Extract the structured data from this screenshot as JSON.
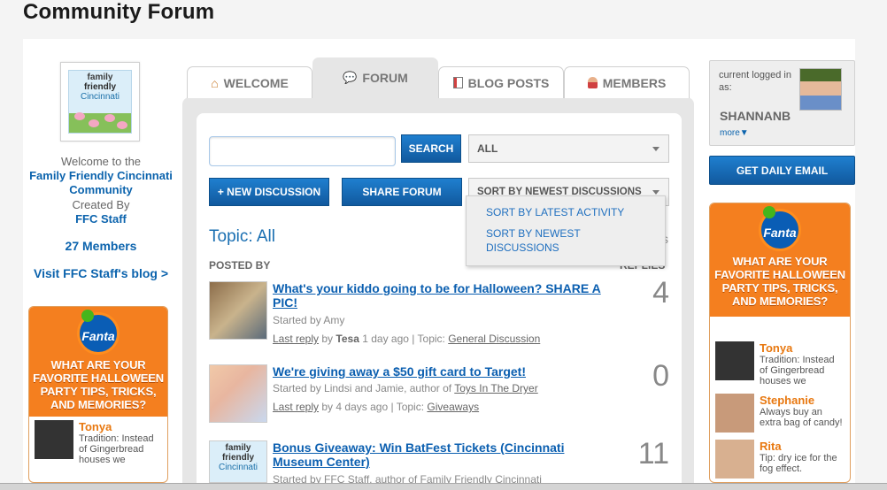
{
  "page_title": "Community Forum",
  "left": {
    "logo": {
      "line1": "family",
      "line2": "friendly",
      "line3": "Cincinnati"
    },
    "welcome_line": "Welcome to the",
    "community_name": "Family Friendly Cincinnati Community",
    "created_by_label": "Created By",
    "creator": "FFC Staff",
    "members": "27 Members",
    "blog_link": "Visit FFC Staff's blog >"
  },
  "ad": {
    "brand": "Fanta",
    "headline": "WHAT ARE YOUR FAVORITE HALLOWEEN PARTY TIPS, TRICKS, AND MEMORIES?",
    "left_items": [
      {
        "name": "Tonya",
        "msg": "Tradition: Instead of Gingerbread houses we"
      }
    ],
    "right_items": [
      {
        "name": "Tonya",
        "msg": "Tradition: Instead of Gingerbread houses we"
      },
      {
        "name": "Stephanie",
        "msg": "Always buy an extra bag of candy!"
      },
      {
        "name": "Rita",
        "msg": "Tip: dry ice for the fog effect."
      }
    ]
  },
  "tabs": [
    {
      "label": "WELCOME",
      "icon": "house-icon"
    },
    {
      "label": "FORUM",
      "icon": "speech-bubbles-icon"
    },
    {
      "label": "BLOG POSTS",
      "icon": "document-icon"
    },
    {
      "label": "MEMBERS",
      "icon": "person-icon"
    }
  ],
  "toolbar": {
    "search_placeholder": "",
    "search_button": "SEARCH",
    "filter_value": "ALL",
    "new_discussion": "+ NEW DISCUSSION",
    "share_forum": "SHARE FORUM",
    "sort_value": "SORT BY NEWEST DISCUSSIONS",
    "sort_options": [
      "SORT BY LATEST ACTIVITY",
      "SORT BY NEWEST DISCUSSIONS"
    ]
  },
  "list": {
    "topic": "Topic: All",
    "topic_suffix": "s",
    "posted_by_header": "POSTED BY",
    "replies_header": "REPLIES",
    "discussions": [
      {
        "title": "What's your kiddo going to be for Halloween? SHARE A PIC!",
        "started": "Started by Amy",
        "started_link": "",
        "last_reply": "Last reply",
        "by_label": "by",
        "last_user": "Tesa",
        "time": "1 day ago",
        "topic_label": "Topic:",
        "topic": "General Discussion",
        "replies": "4"
      },
      {
        "title": "We're giving away a $50 gift card to Target!",
        "started": "Started by Lindsi and Jamie, author of",
        "started_link": "Toys In The Dryer",
        "last_reply": "Last reply",
        "by_label": "by",
        "last_user": "",
        "time": "4 days ago",
        "topic_label": "Topic:",
        "topic": "Giveaways",
        "replies": "0"
      },
      {
        "title": "Bonus Giveaway: Win BatFest Tickets (Cincinnati Museum Center)",
        "started": "Started by FFC Staff, author of Family Friendly Cincinnati",
        "started_link": "",
        "replies": "11"
      }
    ]
  },
  "user": {
    "label": "current logged in as:",
    "name": "SHANNANB",
    "more": "more▼"
  },
  "email_button": "GET DAILY EMAIL",
  "colors": {
    "accent": "#1669b4",
    "ad_orange": "#f47f1f",
    "link": "#0b63ad"
  }
}
